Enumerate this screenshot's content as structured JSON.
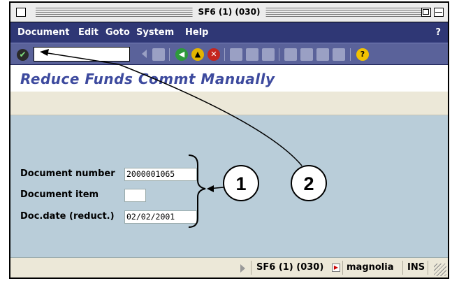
{
  "window": {
    "title": "SF6 (1) (030)"
  },
  "menu": {
    "items": [
      "Document",
      "Edit",
      "Goto",
      "System",
      "Help"
    ],
    "help_q": "?"
  },
  "toolbar": {
    "ok_icon": "check-icon",
    "command_value": "",
    "icons": [
      "back-arrow-icon",
      "save-icon",
      "back-icon",
      "exit-icon",
      "cancel-icon",
      "print-icon",
      "find-icon",
      "find-next-icon",
      "first-page-icon",
      "previous-page-icon",
      "next-page-icon",
      "last-page-icon",
      "help-icon"
    ]
  },
  "header": {
    "title": "Reduce Funds Commt Manually"
  },
  "form": {
    "fields": [
      {
        "label": "Document number",
        "value": "2000001065"
      },
      {
        "label": "Document item",
        "value": ""
      },
      {
        "label": "Doc.date (reduct.)",
        "value": "02/02/2001"
      }
    ]
  },
  "status": {
    "system": "SF6 (1) (030)",
    "server": "magnolia",
    "mode": "INS"
  },
  "annotations": {
    "callout1": "1",
    "callout2": "2"
  },
  "colors": {
    "menubar": "#2f3775",
    "toolbar": "#5a629a",
    "title": "#3d4a9e",
    "form_bg": "#b9cdd9"
  }
}
